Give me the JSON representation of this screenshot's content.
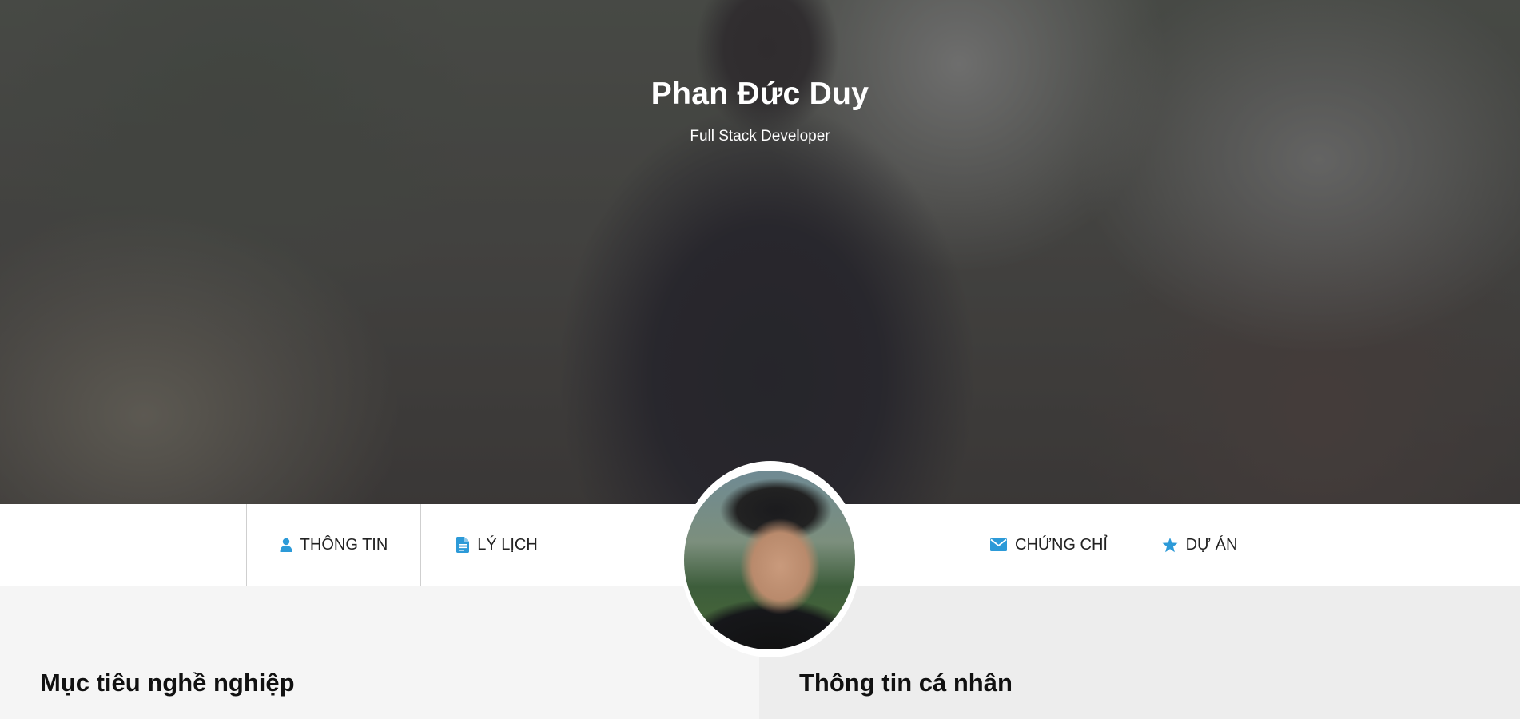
{
  "hero": {
    "name": "Phan Đức Duy",
    "role": "Full Stack Developer"
  },
  "nav": {
    "items": [
      {
        "label": "THÔNG TIN",
        "icon": "user-icon"
      },
      {
        "label": "LÝ LỊCH",
        "icon": "document-icon"
      },
      {
        "label": "CHỨNG CHỈ",
        "icon": "envelope-icon"
      },
      {
        "label": "DỰ ÁN",
        "icon": "star-icon"
      }
    ]
  },
  "sections": {
    "left_title": "Mục tiêu nghề nghiệp",
    "right_title": "Thông tin cá nhân"
  },
  "colors": {
    "accent": "#2c9ad8",
    "nav_bg": "#ffffff",
    "content_left_bg": "#f5f5f5",
    "content_right_bg": "#ededed"
  }
}
